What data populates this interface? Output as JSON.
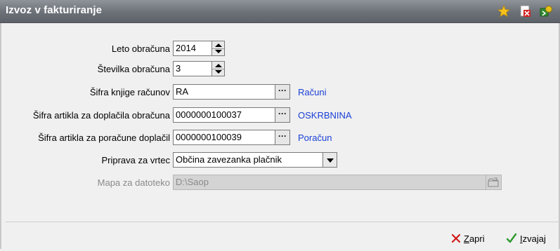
{
  "window": {
    "title": "Izvoz v fakturiranje"
  },
  "toolbar": {
    "icons": [
      "star-icon",
      "pdf-close-icon",
      "export-icon"
    ]
  },
  "form": {
    "leto": {
      "label": "Leto obračuna",
      "value": "2014"
    },
    "stevilka": {
      "label": "Številka obračuna",
      "value": "3"
    },
    "knjiga": {
      "label": "Šifra knjige računov",
      "value": "RA",
      "desc": "Računi"
    },
    "artikel_doplacila": {
      "label": "Šifra artikla za doplačila obračuna",
      "value": "0000000100037",
      "desc": "OSKRBNINA"
    },
    "artikel_poracune": {
      "label": "Šifra artikla za poračune doplačil",
      "value": "0000000100039",
      "desc": "Poračun"
    },
    "priprava": {
      "label": "Priprava za vrtec",
      "value": "Občina zavezanka plačnik"
    },
    "mapa": {
      "label": "Mapa za datoteko",
      "value": "D:\\Saop",
      "enabled": false
    }
  },
  "footer": {
    "zapri": {
      "hotkey": "Z",
      "rest": "apri"
    },
    "izvajaj": {
      "hotkey": "I",
      "rest": "zvajaj"
    }
  },
  "colors": {
    "title_bg": "#6c7178",
    "link_text": "#1a3fd6",
    "close_red": "#d01a1a",
    "check_green": "#2e9a2e"
  }
}
